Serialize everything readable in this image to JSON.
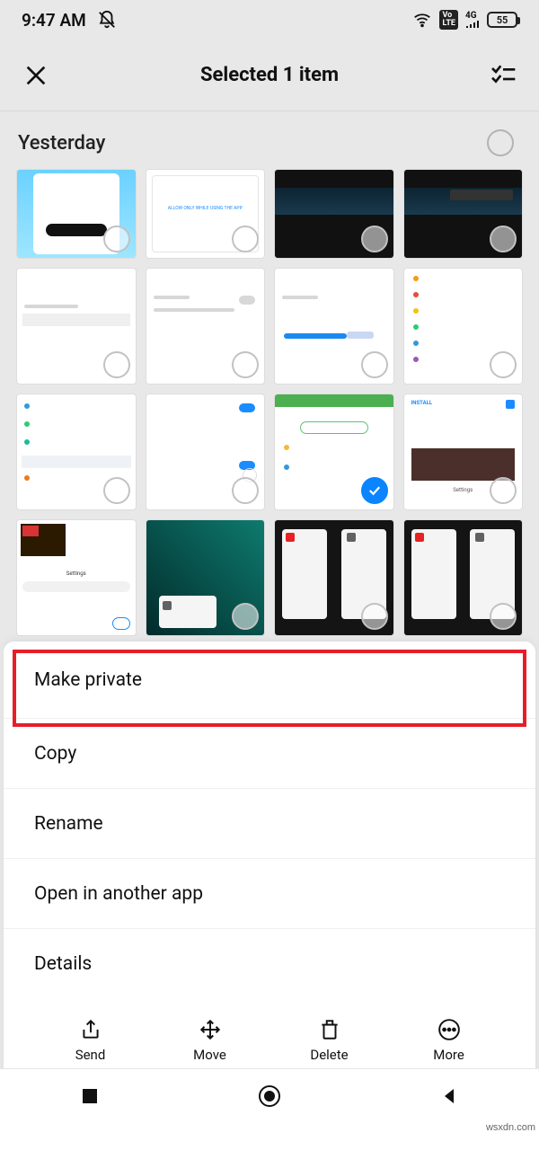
{
  "status": {
    "time": "9:47 AM",
    "battery": "55",
    "network": "4G"
  },
  "header": {
    "title": "Selected 1 item"
  },
  "section": {
    "label": "Yesterday"
  },
  "menu": {
    "make_private": "Make private",
    "copy": "Copy",
    "rename": "Rename",
    "open_in": "Open in another app",
    "details": "Details"
  },
  "actions": {
    "send": "Send",
    "move": "Move",
    "delete": "Delete",
    "more": "More"
  },
  "watermark": "wsxdn.com"
}
